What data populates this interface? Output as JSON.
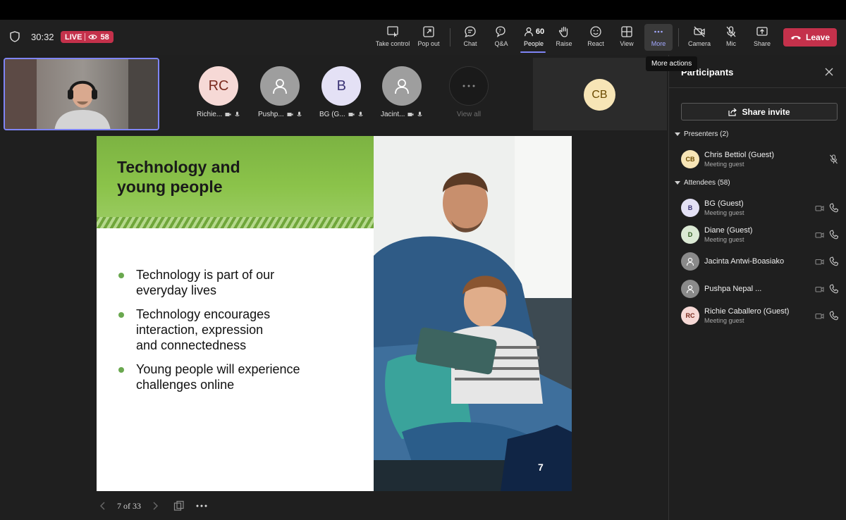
{
  "header": {
    "timer": "30:32",
    "live_label": "LIVE",
    "viewer_count": "58"
  },
  "toolbar": {
    "take_control": "Take control",
    "pop_out": "Pop out",
    "chat": "Chat",
    "qa": "Q&A",
    "people": "People",
    "people_count": "60",
    "raise": "Raise",
    "react": "React",
    "view": "View",
    "more": "More",
    "camera": "Camera",
    "mic": "Mic",
    "share": "Share",
    "leave": "Leave",
    "tooltip": "More actions"
  },
  "gallery": [
    {
      "initials": "RC",
      "name": "Richie...",
      "bg": "#f6d9d6",
      "fg": "#7a2a1e"
    },
    {
      "initials": "",
      "name": "Pushp...",
      "bg": "#9e9e9e",
      "fg": "#ffffff"
    },
    {
      "initials": "B",
      "name": "BG (G...",
      "bg": "#e4e1f5",
      "fg": "#3b3475"
    },
    {
      "initials": "",
      "name": "Jacint...",
      "bg": "#9e9e9e",
      "fg": "#ffffff"
    },
    {
      "initials": "",
      "name": "View all",
      "bg": "#1a1a1a",
      "fg": "#8a8a8a"
    }
  ],
  "presenter_tile": {
    "initials": "CB",
    "bg": "#f7e5b6",
    "fg": "#6b4a00"
  },
  "slide": {
    "title_line1": "Technology and",
    "title_line2": "young people",
    "bullets": [
      "Technology is part of our\neveryday lives",
      "Technology encourages\ninteraction, expression\nand connectedness",
      "Young people will experience\nchallenges online"
    ],
    "page_number": "7"
  },
  "slide_nav": {
    "position": "7 of 33"
  },
  "panel": {
    "title": "Participants",
    "share_invite": "Share invite",
    "presenters_header": "Presenters (2)",
    "attendees_header": "Attendees (58)",
    "presenters": [
      {
        "initials": "CB",
        "name": "Chris Bettiol (Guest)",
        "sub": "Meeting guest",
        "bg": "#f7e5b6",
        "fg": "#6b4a00"
      }
    ],
    "attendees": [
      {
        "initials": "B",
        "name": "BG (Guest)",
        "sub": "Meeting guest",
        "bg": "#e4e1f5",
        "fg": "#3b3475"
      },
      {
        "initials": "D",
        "name": "Diane (Guest)",
        "sub": "Meeting guest",
        "bg": "#dbe9d4",
        "fg": "#2f5a1e"
      },
      {
        "initials": "",
        "name": "Jacinta Antwi-Boasiako",
        "sub": "",
        "bg": "#8a8a8a",
        "fg": "#ffffff"
      },
      {
        "initials": "",
        "name": "Pushpa Nepal ...",
        "sub": "",
        "bg": "#8a8a8a",
        "fg": "#ffffff"
      },
      {
        "initials": "RC",
        "name": "Richie Caballero (Guest)",
        "sub": "Meeting guest",
        "bg": "#f6d9d6",
        "fg": "#7a2a1e"
      }
    ]
  },
  "colors": {
    "accent": "#7f85f5",
    "leave": "#c4314b",
    "slide_green": "#8bc34a"
  }
}
